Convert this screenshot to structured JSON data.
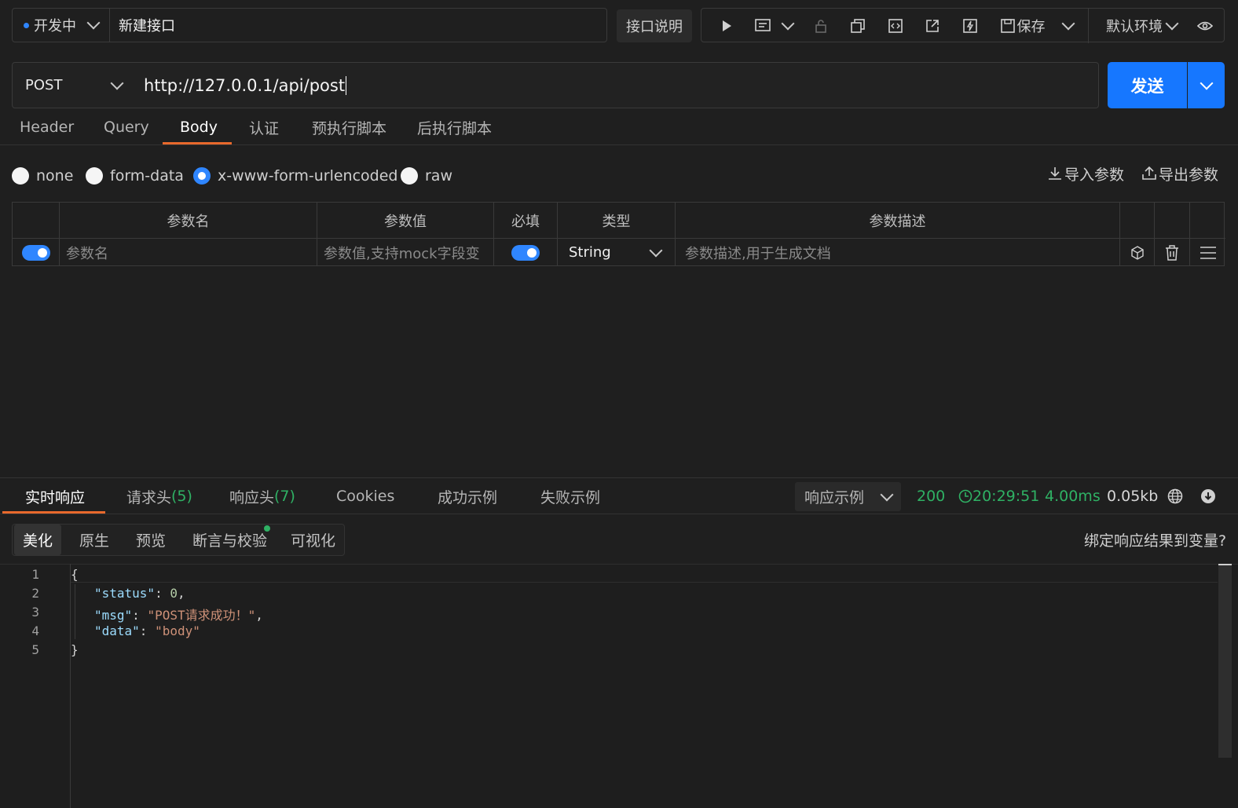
{
  "topbar": {
    "env_status": "开发中",
    "api_name": "新建接口",
    "doc_button": "接口说明",
    "save_label": "保存",
    "env_select": "默认环境"
  },
  "request": {
    "method": "POST",
    "url": "http://127.0.0.1/api/post",
    "send_label": "发送"
  },
  "req_tabs": [
    "Header",
    "Query",
    "Body",
    "认证",
    "预执行脚本",
    "后执行脚本"
  ],
  "body_types": [
    "none",
    "form-data",
    "x-www-form-urlencoded",
    "raw"
  ],
  "body_selected": "x-www-form-urlencoded",
  "import_label": "导入参数",
  "export_label": "导出参数",
  "param_table": {
    "headers": [
      "参数名",
      "参数值",
      "必填",
      "类型",
      "参数描述"
    ],
    "row": {
      "name_placeholder": "参数名",
      "value_placeholder": "参数值,支持mock字段变",
      "type": "String",
      "desc_placeholder": "参数描述,用于生成文档"
    }
  },
  "response": {
    "tabs": {
      "realtime": "实时响应",
      "req_headers": "请求头",
      "req_headers_count": "(5)",
      "resp_headers": "响应头",
      "resp_headers_count": "(7)",
      "cookies": "Cookies",
      "success": "成功示例",
      "fail": "失败示例"
    },
    "example_select": "响应示例",
    "status_code": "200",
    "time": "20:29:51",
    "duration": "4.00ms",
    "size": "0.05kb",
    "sub_tabs": [
      "美化",
      "原生",
      "预览",
      "断言与校验",
      "可视化"
    ],
    "bind_label": "绑定响应结果到变量?",
    "line_numbers": [
      "1",
      "2",
      "3",
      "4",
      "5"
    ],
    "json": {
      "open": "{",
      "status_key": "\"status\"",
      "status_val": "0",
      "msg_key": "\"msg\"",
      "msg_val": "\"POST请求成功！\"",
      "data_key": "\"data\"",
      "data_val": "\"body\"",
      "close": "}"
    }
  },
  "colors": {
    "accent": "#1677ff",
    "active_tab": "#e8692c",
    "status_green": "#2fb164"
  }
}
